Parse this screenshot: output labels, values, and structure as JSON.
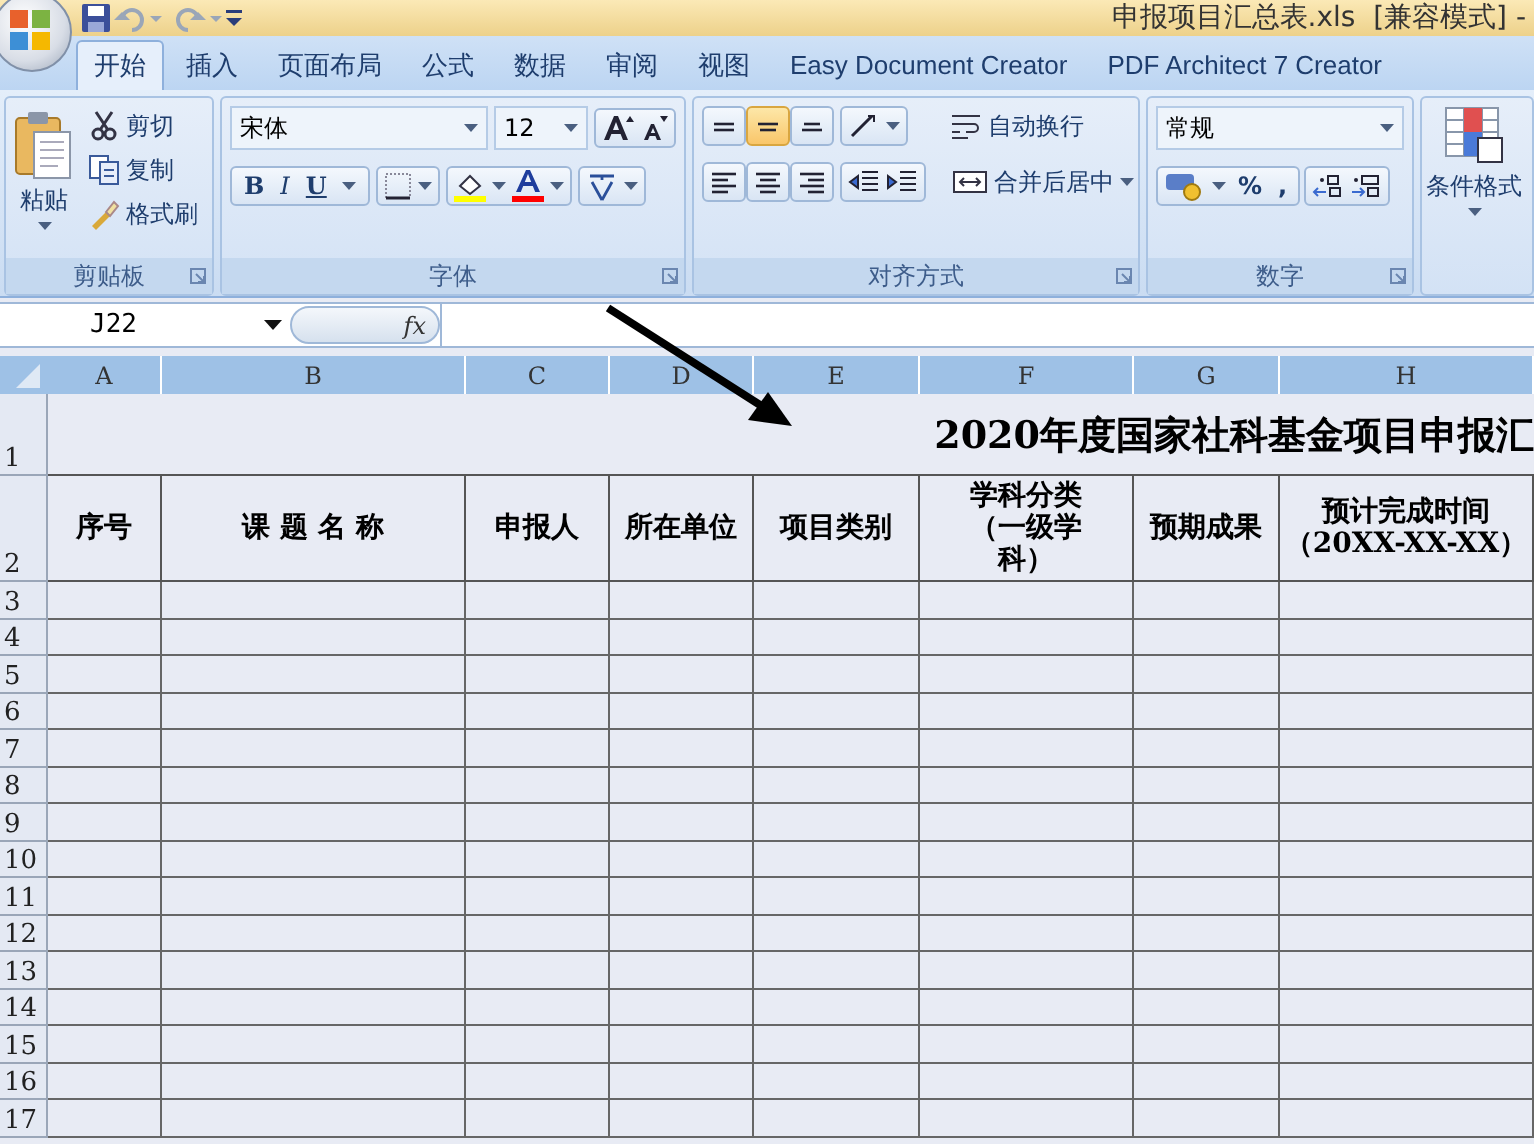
{
  "title_bar": {
    "title": "申报项目汇总表.xls  [兼容模式] -"
  },
  "tabs": [
    {
      "label": "开始",
      "selected": true
    },
    {
      "label": "插入",
      "selected": false
    },
    {
      "label": "页面布局",
      "selected": false
    },
    {
      "label": "公式",
      "selected": false
    },
    {
      "label": "数据",
      "selected": false
    },
    {
      "label": "审阅",
      "selected": false
    },
    {
      "label": "视图",
      "selected": false
    },
    {
      "label": "Easy Document Creator",
      "selected": false
    },
    {
      "label": "PDF Architect 7 Creator",
      "selected": false
    }
  ],
  "ribbon": {
    "clipboard": {
      "paste": "粘贴",
      "items": [
        {
          "label": "剪切",
          "kind": "cut"
        },
        {
          "label": "复制",
          "kind": "copy"
        },
        {
          "label": "格式刷",
          "kind": "brush"
        }
      ],
      "group_label": "剪贴板"
    },
    "font": {
      "font_name": "宋体",
      "font_size": "12",
      "styles": [
        {
          "label": "B",
          "kind": "bold"
        },
        {
          "label": "I",
          "kind": "italic"
        },
        {
          "label": "U",
          "kind": "underline"
        }
      ],
      "group_label": "字体"
    },
    "alignment": {
      "vertical": [
        {
          "kind": "top",
          "selected": false
        },
        {
          "kind": "middle",
          "selected": true
        },
        {
          "kind": "bottom",
          "selected": false
        }
      ],
      "horizontal": [
        {
          "kind": "left",
          "selected": false
        },
        {
          "kind": "center",
          "selected": false
        },
        {
          "kind": "right",
          "selected": false
        }
      ],
      "wrap_text": "自动换行",
      "merge_center": "合并后居中",
      "group_label": "对齐方式"
    },
    "number": {
      "format": "常规",
      "symbols": [
        "%",
        ","
      ],
      "group_label": "数字"
    },
    "styles": {
      "conditional_format": "条件格式"
    }
  },
  "formula_bar": {
    "name_box": "J22",
    "fx": "fx"
  },
  "sheet": {
    "columns": [
      "A",
      "B",
      "C",
      "D",
      "E",
      "F",
      "G",
      "H"
    ],
    "row_numbers": [
      "1",
      "2",
      "3",
      "4",
      "5",
      "6",
      "7",
      "8",
      "9",
      "10",
      "11",
      "12",
      "13",
      "14",
      "15",
      "16",
      "17"
    ],
    "title": "2020年度国家社科基金项目申报汇",
    "headers": [
      {
        "lines": [
          "序号"
        ]
      },
      {
        "lines": [
          "课 题 名 称"
        ]
      },
      {
        "lines": [
          "申报人"
        ]
      },
      {
        "lines": [
          "所在单位"
        ]
      },
      {
        "lines": [
          "项目类别"
        ]
      },
      {
        "lines": [
          "学科分类",
          "（一级学",
          "科）"
        ]
      },
      {
        "lines": [
          "预期成果"
        ]
      },
      {
        "lines": [
          "预计完成时间",
          "（20XX-XX-XX）"
        ]
      }
    ]
  }
}
